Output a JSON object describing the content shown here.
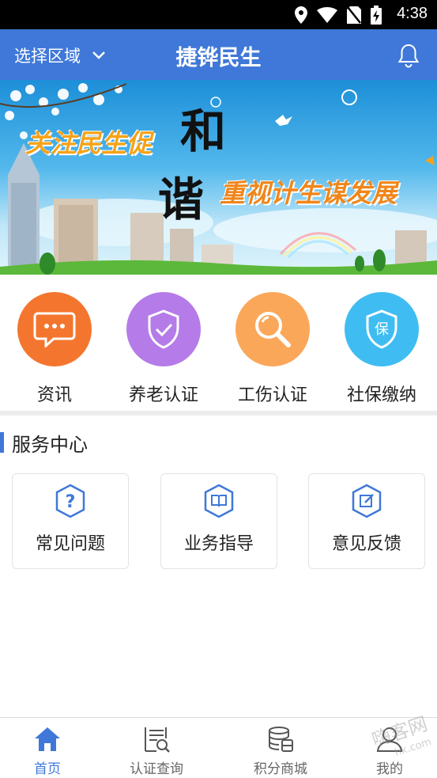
{
  "status_bar": {
    "time": "4:38"
  },
  "app_bar": {
    "region_label": "选择区域",
    "title": "捷铧民生"
  },
  "banner": {
    "slogan_left": "关注民生促",
    "callig_1": "和",
    "callig_2": "谐",
    "slogan_right": "重视计生谋发展"
  },
  "quick_actions": [
    {
      "label": "资讯",
      "color": "#f4762e",
      "icon": "chat-bubble-icon"
    },
    {
      "label": "养老认证",
      "color": "#b57be8",
      "icon": "shield-check-icon"
    },
    {
      "label": "工伤认证",
      "color": "#fba75a",
      "icon": "magnifier-icon"
    },
    {
      "label": "社保缴纳",
      "color": "#3fbdf2",
      "icon": "bao-shield-icon"
    }
  ],
  "service_center": {
    "title": "服务中心",
    "items": [
      {
        "label": "常见问题",
        "icon": "question-hex-icon"
      },
      {
        "label": "业务指导",
        "icon": "book-hex-icon"
      },
      {
        "label": "意见反馈",
        "icon": "edit-hex-icon"
      }
    ]
  },
  "tab_bar": {
    "tabs": [
      {
        "label": "首页",
        "icon": "home-icon"
      },
      {
        "label": "认证查询",
        "icon": "doc-search-icon"
      },
      {
        "label": "积分商城",
        "icon": "database-icon"
      },
      {
        "label": "我的",
        "icon": "user-icon"
      }
    ]
  },
  "watermark": {
    "line1": "嗨客网",
    "line2": "hk.com"
  },
  "colors": {
    "primary": "#3f78d8",
    "tab_inactive": "#666666"
  }
}
